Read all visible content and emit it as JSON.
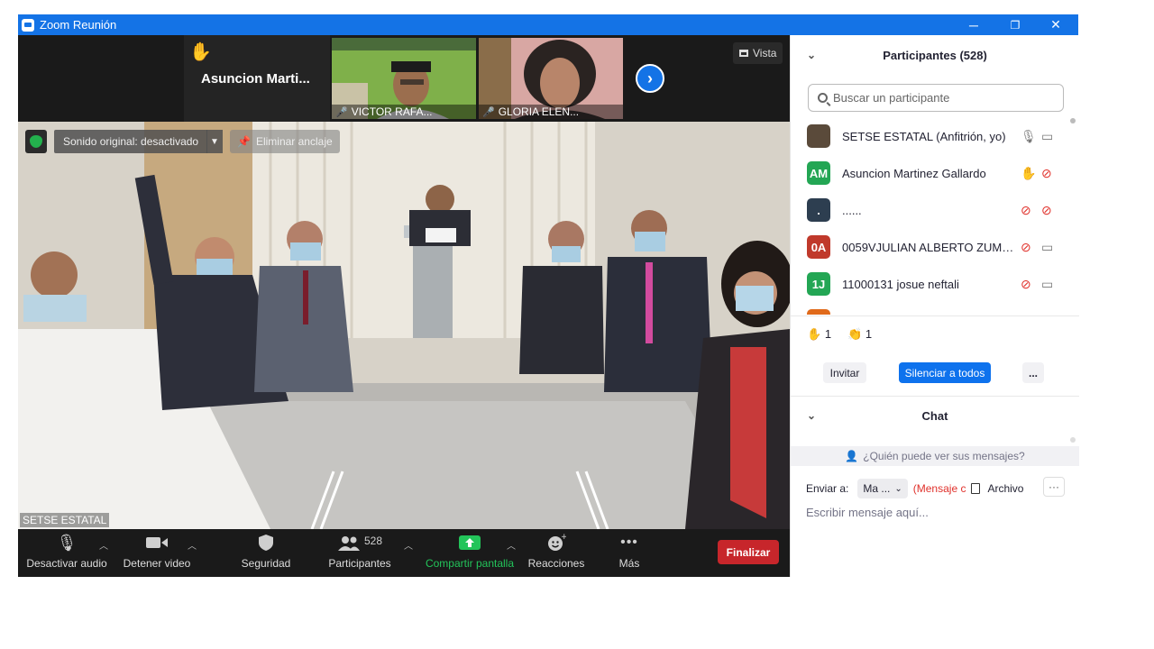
{
  "window": {
    "title": "Zoom Reunión",
    "minimize": "─",
    "restore": "❐",
    "close": "✕"
  },
  "strip": {
    "raised_hand_name": "Asuncion  Marti...",
    "thumbnails": [
      {
        "name": "VICTOR RAFA..."
      },
      {
        "name": "GLORIA ELEN..."
      }
    ],
    "next_glyph": "›",
    "view_label": "Vista"
  },
  "video": {
    "sound_status": "Sonido original: desactivado",
    "unpin_label": "Eliminar anclaje",
    "speaker_name": "SETSE ESTATAL"
  },
  "toolbar": {
    "mute_label": "Desactivar audio",
    "stop_video_label": "Detener video",
    "security_label": "Seguridad",
    "participants_label": "Participantes",
    "participants_count": "528",
    "share_label": "Compartir pantalla",
    "reactions_label": "Reacciones",
    "more_label": "Más",
    "end_label": "Finalizar"
  },
  "participants": {
    "header": "Participantes (528)",
    "search_placeholder": "Buscar un participante",
    "list": [
      {
        "initials": "",
        "name": "SETSE ESTATAL (Anfitrión, yo)",
        "color": "#5a4a3a"
      },
      {
        "initials": "AM",
        "name": "Asuncion Martinez Gallardo",
        "color": "#23a654"
      },
      {
        "initials": ".",
        "name": "......",
        "color": "#2d3e50"
      },
      {
        "initials": "0A",
        "name": "0059VJULIAN ALBERTO ZUMAYA...",
        "color": "#c0392b"
      },
      {
        "initials": "1J",
        "name": "11000131 josue neftali",
        "color": "#23a654"
      }
    ],
    "reactions": {
      "hand_count": "1",
      "clap_count": "1"
    },
    "invite_label": "Invitar",
    "mute_all_label": "Silenciar a todos",
    "more_label": "..."
  },
  "chat": {
    "header": "Chat",
    "who_can_see": "¿Quién puede ver sus mensajes?",
    "send_to_label": "Enviar a:",
    "recipient": "Ma ...",
    "private_note": "(Mensaje c",
    "file_label": "Archivo",
    "more_label": "···",
    "input_placeholder": "Escribir mensaje aquí..."
  }
}
